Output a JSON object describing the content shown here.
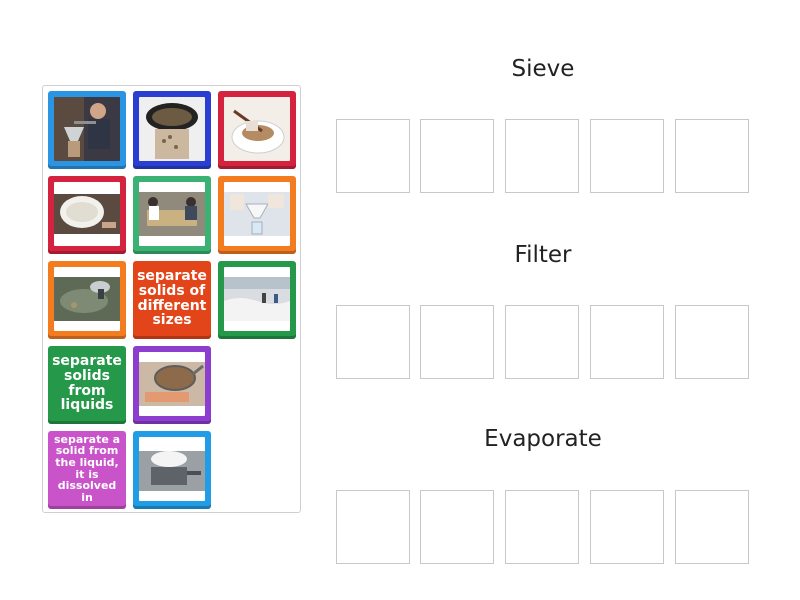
{
  "tiles": [
    {
      "type": "image",
      "name": "tile-pour-over-coffee-image",
      "color": "#2b95e4"
    },
    {
      "type": "image",
      "name": "tile-grain-sieve-image",
      "color": "#2a3fd1"
    },
    {
      "type": "image",
      "name": "tile-tea-strainer-image",
      "color": "#d3233f"
    },
    {
      "type": "image",
      "name": "tile-flour-sieve-image",
      "color": "#d3233f"
    },
    {
      "type": "image",
      "name": "tile-sand-sifting-image",
      "color": "#3bb173"
    },
    {
      "type": "image",
      "name": "tile-lab-filter-image",
      "color": "#f47c20"
    },
    {
      "type": "image",
      "name": "tile-gold-panning-image",
      "color": "#f47c20"
    },
    {
      "type": "text",
      "label": "separate solids of different sizes",
      "color": "#e3451a"
    },
    {
      "type": "image",
      "name": "tile-salt-flats-image",
      "color": "#26984a"
    },
    {
      "type": "text",
      "label": "separate solids from liquids",
      "color": "#26984a"
    },
    {
      "type": "image",
      "name": "tile-kitchen-sieve-image",
      "color": "#8c3fcf"
    },
    {
      "type": "text",
      "label": "separate a solid from the liquid, it is dissolved in",
      "color": "#c954c9"
    },
    {
      "type": "image",
      "name": "tile-boiling-pot-image",
      "color": "#209de4"
    }
  ],
  "groups": [
    {
      "title": "Sieve"
    },
    {
      "title": "Filter"
    },
    {
      "title": "Evaporate"
    }
  ]
}
